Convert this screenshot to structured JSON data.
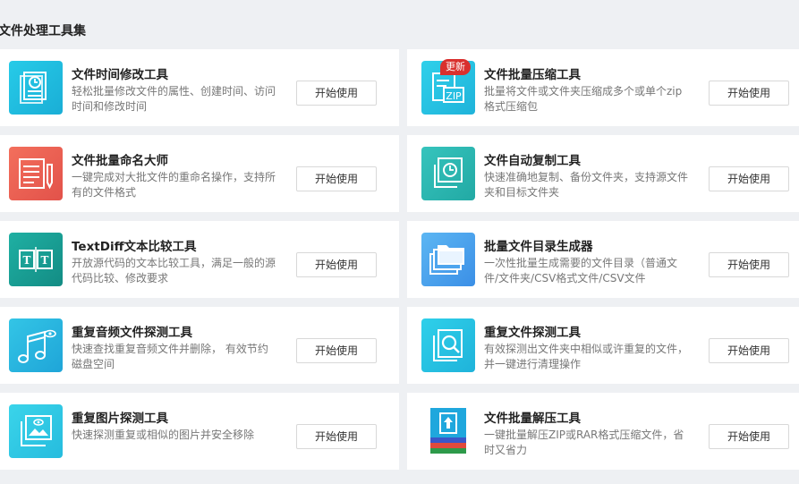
{
  "section": {
    "title": "文件处理工具集"
  },
  "badge_new": "更新",
  "tools": [
    {
      "title": "文件时间修改工具",
      "desc": "轻松批量修改文件的属性、创建时间、访问时间和修改时间",
      "button": "开始使用",
      "icon": "document-clock-icon",
      "color": "#22c1df"
    },
    {
      "title": "文件批量压缩工具",
      "desc": "批量将文件或文件夹压缩成多个或单个zip格式压缩包",
      "button": "开始使用",
      "icon": "zip-file-icon",
      "color": "#28c7e6"
    },
    {
      "title": "文件批量命名大师",
      "desc": "一键完成对大批文件的重命名操作，支持所有的文件格式",
      "button": "开始使用",
      "icon": "rename-document-icon",
      "color": "#ee5f52"
    },
    {
      "title": "文件自动复制工具",
      "desc": "快速准确地复制、备份文件夹，支持源文件夹和目标文件夹",
      "button": "开始使用",
      "icon": "copy-clock-icon",
      "color": "#2ab6b0"
    },
    {
      "title": "TextDiff文本比较工具",
      "desc": "开放源代码的文本比较工具，满足一般的源代码比较、修改要求",
      "button": "开始使用",
      "icon": "text-compare-icon",
      "color": "#169e94"
    },
    {
      "title": "批量文件目录生成器",
      "desc": "一次性批量生成需要的文件目录（普通文件/文件夹/CSV格式文件/CSV文件",
      "button": "开始使用",
      "icon": "folder-stack-icon",
      "color": "#4da8ef"
    },
    {
      "title": "重复音频文件探测工具",
      "desc": "快速查找重复音频文件并删除， 有效节约磁盘空间",
      "button": "开始使用",
      "icon": "music-notes-icon",
      "color": "#2ab7df"
    },
    {
      "title": "重复文件探测工具",
      "desc": "有效探测出文件夹中相似或许重复的文件，并一键进行清理操作",
      "button": "开始使用",
      "icon": "file-search-icon",
      "color": "#28c7e6"
    },
    {
      "title": "重复图片探测工具",
      "desc": "快速探测重复或相似的图片并安全移除",
      "button": "开始使用",
      "icon": "image-duplicate-icon",
      "color": "#30cde4"
    },
    {
      "title": "文件批量解压工具",
      "desc": "一键批量解压ZIP或RAR格式压缩文件，省时又省力",
      "button": "开始使用",
      "icon": "unzip-stack-icon",
      "color": "#1f9fd9"
    }
  ]
}
